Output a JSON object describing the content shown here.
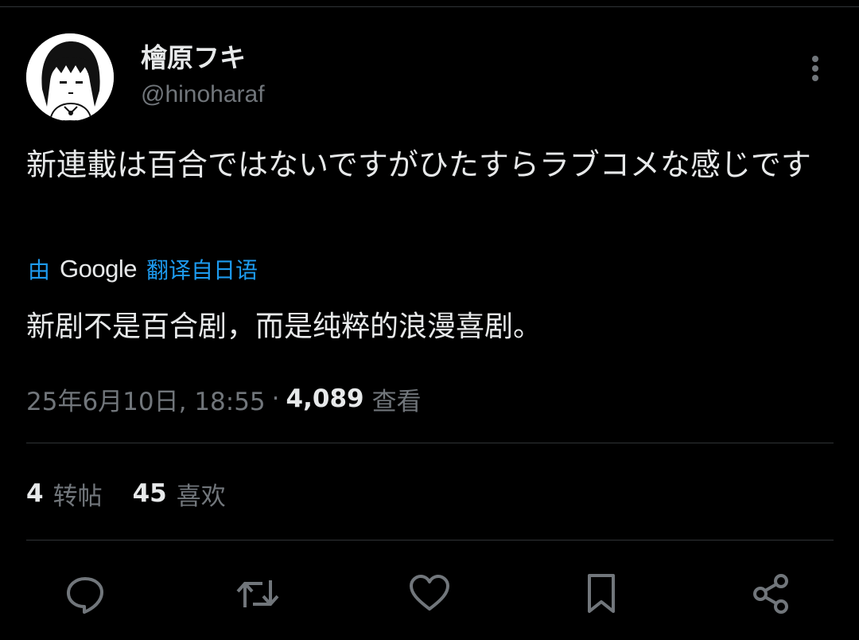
{
  "author": {
    "display_name": "檜原フキ",
    "handle": "@hinoharaf"
  },
  "tweet": {
    "text": "新連載は百合ではないですがひたすらラブコメな感じです",
    "translation": {
      "prefix": "由",
      "provider": "Google",
      "suffix": "翻译自日语",
      "text": "新剧不是百合剧，而是纯粹的浪漫喜剧。"
    },
    "timestamp": "25年6月10日, 18:55",
    "separator": "·",
    "views_count": "4,089",
    "views_label": "查看"
  },
  "stats": {
    "retweets_count": "4",
    "retweets_label": "转帖",
    "likes_count": "45",
    "likes_label": "喜欢"
  },
  "icons": {
    "more": "more-vertical-icon",
    "reply": "reply-icon",
    "retweet": "retweet-icon",
    "like": "heart-icon",
    "bookmark": "bookmark-icon",
    "share": "share-icon"
  },
  "colors": {
    "background": "#000000",
    "primary_text": "#e7e9ea",
    "secondary_text": "#71767b",
    "link_blue": "#1d9bf0",
    "divider": "#2f3336"
  }
}
